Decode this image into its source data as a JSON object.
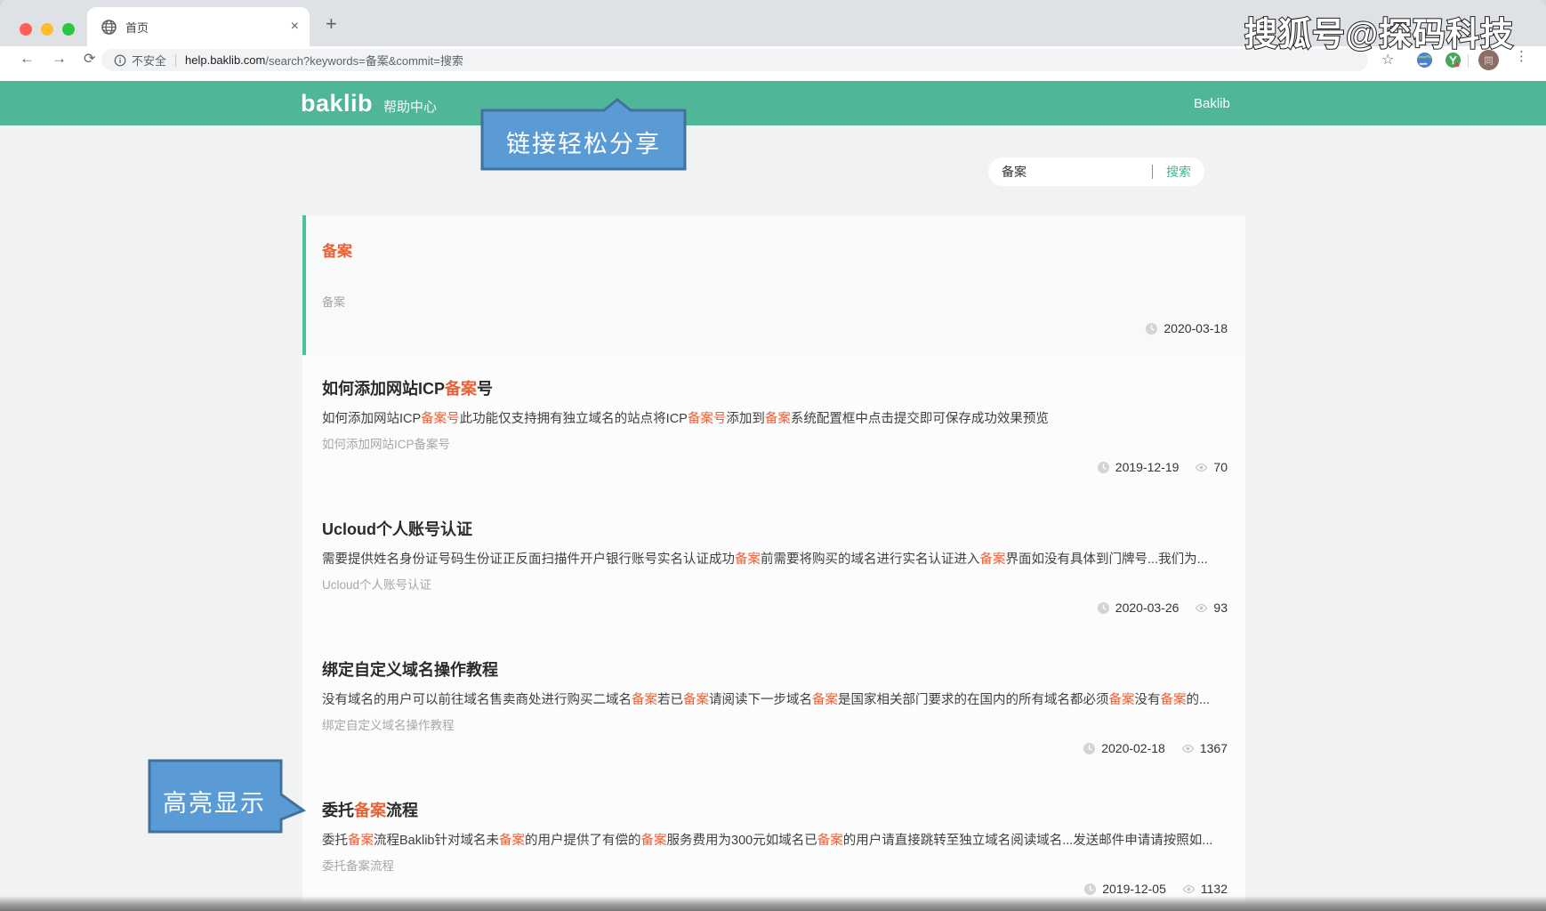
{
  "watermark": "搜狐号@探码科技",
  "colors": {
    "header_teal": "#4fb697",
    "accent_teal": "#3cb593",
    "card_border_teal": "#4cc397",
    "highlight_orange": "#e8623a",
    "callout_fill": "#5b9bd5",
    "callout_border": "#41719c"
  },
  "browser": {
    "tab_title": "首页",
    "tab_close_glyph": "×",
    "new_tab_glyph": "+",
    "back_glyph": "←",
    "forward_glyph": "→",
    "reload_glyph": "⟳",
    "security_label": "不安全",
    "url_host": "help.baklib.com",
    "url_path": "/search?keywords=备案&commit=搜索",
    "star_glyph": "☆",
    "menu_glyph": "⋮",
    "avatar_label": "同"
  },
  "site_header": {
    "logo": "baklib",
    "logo_suffix": "帮助中心",
    "nav_link": "Baklib"
  },
  "search": {
    "value": "备案",
    "button_label": "搜索"
  },
  "callouts": {
    "share": "链接轻松分享",
    "highlight": "高亮显示"
  },
  "featured_result": {
    "title": "备案",
    "breadcrumb": "备案",
    "date": "2020-03-18"
  },
  "results": [
    {
      "title_parts": [
        {
          "t": "如何添加网站ICP"
        },
        {
          "t": "备案",
          "hl": true
        },
        {
          "t": "号"
        }
      ],
      "body_parts": [
        {
          "t": "如何添加网站ICP"
        },
        {
          "t": "备案号",
          "hl": true
        },
        {
          "t": "此功能仅支持拥有独立域名的站点将ICP"
        },
        {
          "t": "备案号",
          "hl": true
        },
        {
          "t": "添加到"
        },
        {
          "t": "备案",
          "hl": true
        },
        {
          "t": "系统配置框中点击提交即可保存成功效果预览"
        }
      ],
      "breadcrumb": "如何添加网站ICP备案号",
      "date": "2019-12-19",
      "views": "70"
    },
    {
      "title_parts": [
        {
          "t": "Ucloud个人账号认证"
        }
      ],
      "body_parts": [
        {
          "t": "需要提供姓名身份证号码生份证正反面扫描件开户银行账号实名认证成功"
        },
        {
          "t": "备案",
          "hl": true
        },
        {
          "t": "前需要将购买的域名进行实名认证进入"
        },
        {
          "t": "备案",
          "hl": true
        },
        {
          "t": "界面如没有具体到门牌号...我们为..."
        }
      ],
      "breadcrumb": "Ucloud个人账号认证",
      "date": "2020-03-26",
      "views": "93"
    },
    {
      "title_parts": [
        {
          "t": "绑定自定义域名操作教程"
        }
      ],
      "body_parts": [
        {
          "t": "没有域名的用户可以前往域名售卖商处进行购买二域名"
        },
        {
          "t": "备案",
          "hl": true
        },
        {
          "t": "若已"
        },
        {
          "t": "备案",
          "hl": true
        },
        {
          "t": "请阅读下一步域名"
        },
        {
          "t": "备案",
          "hl": true
        },
        {
          "t": "是国家相关部门要求的在国内的所有域名都必须"
        },
        {
          "t": "备案",
          "hl": true
        },
        {
          "t": "没有"
        },
        {
          "t": "备案",
          "hl": true
        },
        {
          "t": "的..."
        }
      ],
      "breadcrumb": "绑定自定义域名操作教程",
      "date": "2020-02-18",
      "views": "1367"
    },
    {
      "title_parts": [
        {
          "t": "委托"
        },
        {
          "t": "备案",
          "hl": true
        },
        {
          "t": "流程"
        }
      ],
      "body_parts": [
        {
          "t": "委托"
        },
        {
          "t": "备案",
          "hl": true
        },
        {
          "t": "流程Baklib针对域名未"
        },
        {
          "t": "备案",
          "hl": true
        },
        {
          "t": "的用户提供了有偿的"
        },
        {
          "t": "备案",
          "hl": true
        },
        {
          "t": "服务费用为300元如域名已"
        },
        {
          "t": "备案",
          "hl": true
        },
        {
          "t": "的用户请直接跳转至独立域名阅读域名...发送邮件申请请按照如..."
        }
      ],
      "breadcrumb": "委托备案流程",
      "date": "2019-12-05",
      "views": "1132"
    }
  ]
}
